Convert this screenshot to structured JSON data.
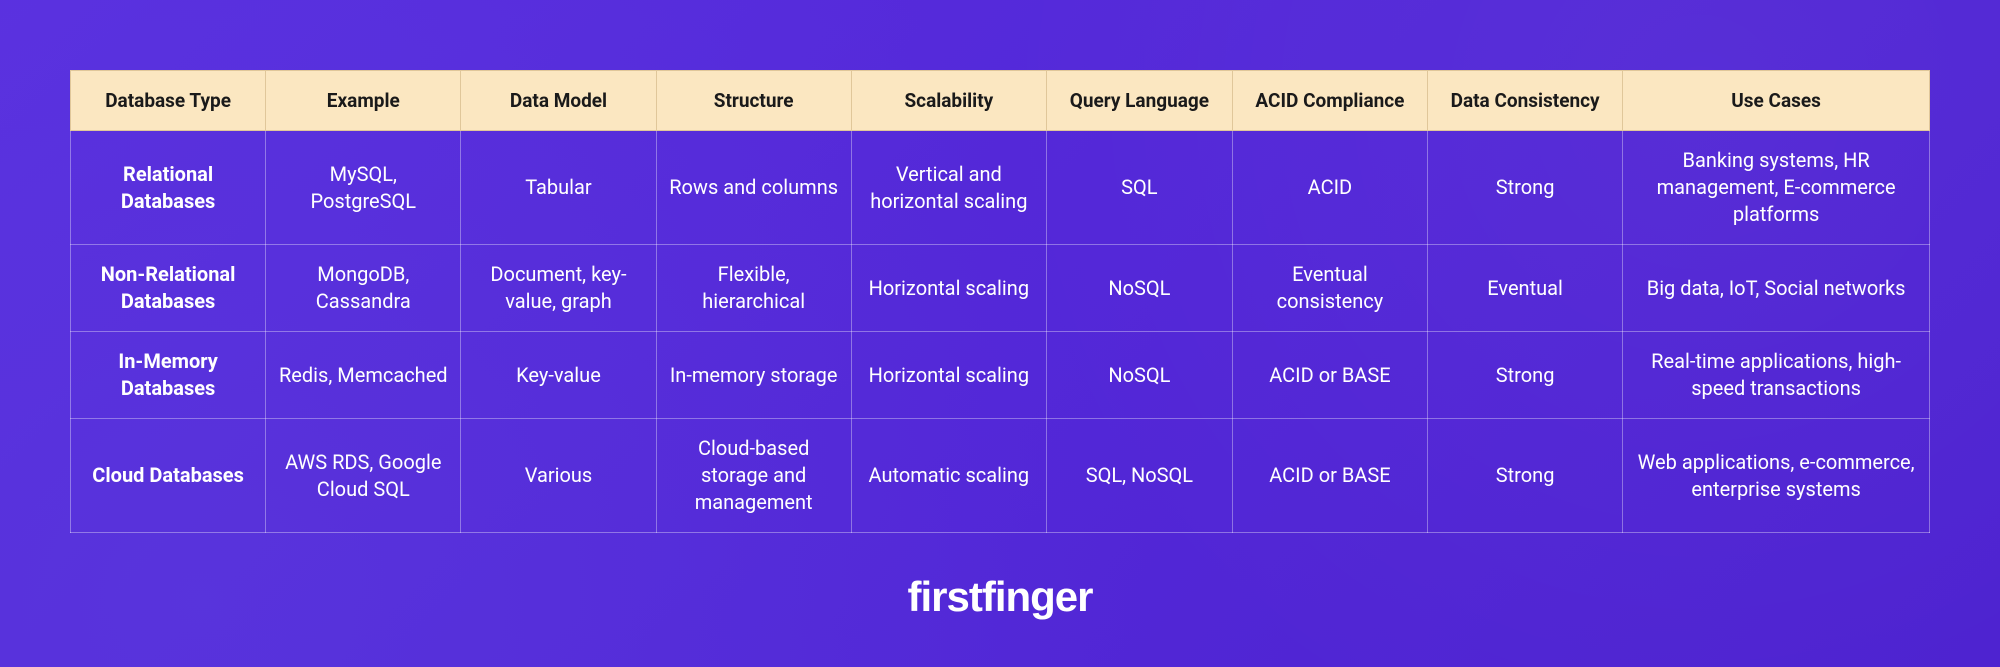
{
  "chart_data": {
    "type": "table",
    "headers": [
      "Database Type",
      "Example",
      "Data Model",
      "Structure",
      "Scalability",
      "Query Language",
      "ACID Compliance",
      "Data Consistency",
      "Use Cases"
    ],
    "rows": [
      {
        "Database Type": "Relational Databases",
        "Example": "MySQL, PostgreSQL",
        "Data Model": "Tabular",
        "Structure": "Rows and columns",
        "Scalability": "Vertical and horizontal scaling",
        "Query Language": "SQL",
        "ACID Compliance": "ACID",
        "Data Consistency": "Strong",
        "Use Cases": "Banking systems, HR management, E-commerce platforms"
      },
      {
        "Database Type": "Non-Relational Databases",
        "Example": "MongoDB, Cassandra",
        "Data Model": "Document, key-value, graph",
        "Structure": "Flexible, hierarchical",
        "Scalability": "Horizontal scaling",
        "Query Language": "NoSQL",
        "ACID Compliance": "Eventual consistency",
        "Data Consistency": "Eventual",
        "Use Cases": "Big data, IoT, Social networks"
      },
      {
        "Database Type": "In-Memory Databases",
        "Example": "Redis, Memcached",
        "Data Model": "Key-value",
        "Structure": "In-memory storage",
        "Scalability": "Horizontal scaling",
        "Query Language": "NoSQL",
        "ACID Compliance": "ACID or BASE",
        "Data Consistency": "Strong",
        "Use Cases": "Real-time applications, high-speed transactions"
      },
      {
        "Database Type": "Cloud Databases",
        "Example": "AWS RDS, Google Cloud SQL",
        "Data Model": "Various",
        "Structure": "Cloud-based storage and management",
        "Scalability": "Automatic scaling",
        "Query Language": "SQL, NoSQL",
        "ACID Compliance": "ACID or BASE",
        "Data Consistency": "Strong",
        "Use Cases": "Web applications, e-commerce, enterprise systems"
      }
    ]
  },
  "brand": "firstfinger"
}
